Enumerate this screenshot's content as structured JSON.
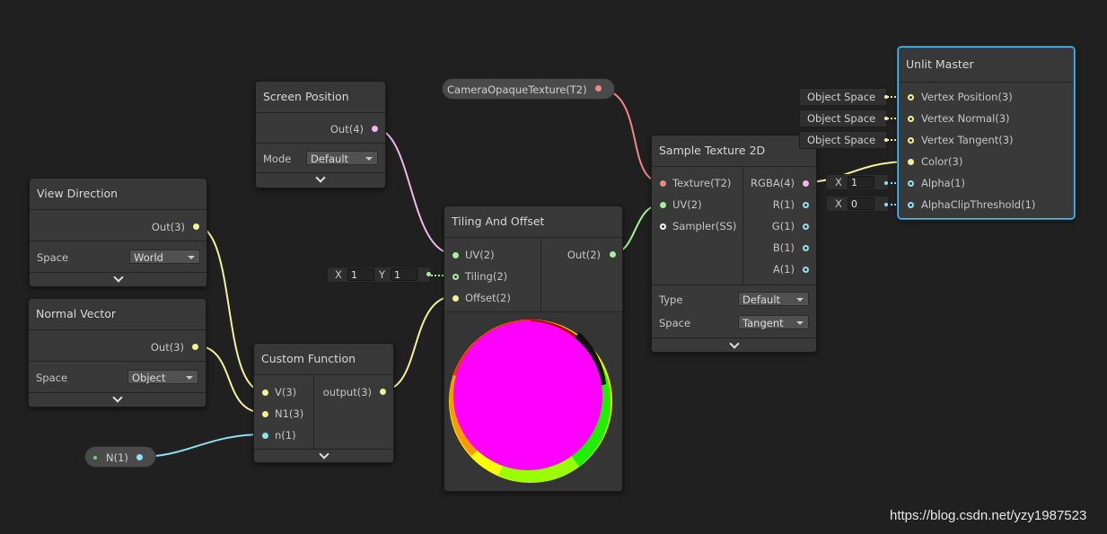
{
  "colors": {
    "vector3": "#f5f09a",
    "vector2": "#a6ef9b",
    "vector4": "#f2b6ee",
    "vector1": "#8fe1f3",
    "texture": "#f28585",
    "sampler": "#ffffff"
  },
  "screen_position": {
    "title": "Screen Position",
    "out_label": "Out(4)",
    "mode_label": "Mode",
    "mode_value": "Default"
  },
  "camera_texture": {
    "label": "CameraOpaqueTexture(T2)"
  },
  "view_direction": {
    "title": "View Direction",
    "out_label": "Out(3)",
    "space_label": "Space",
    "space_value": "World"
  },
  "normal_vector": {
    "title": "Normal Vector",
    "out_label": "Out(3)",
    "space_label": "Space",
    "space_value": "Object"
  },
  "tiling_offset": {
    "title": "Tiling And Offset",
    "uv_label": "UV(2)",
    "tiling_label": "Tiling(2)",
    "offset_label": "Offset(2)",
    "out_label": "Out(2)",
    "tiling_x_label": "X",
    "tiling_x_value": "1",
    "tiling_y_label": "Y",
    "tiling_y_value": "1"
  },
  "custom_function": {
    "title": "Custom Function",
    "inputs": [
      "V(3)",
      "N1(3)",
      "n(1)"
    ],
    "out_label": "output(3)"
  },
  "n_property": {
    "label": "N(1)"
  },
  "sample_texture": {
    "title": "Sample Texture 2D",
    "inputs": [
      "Texture(T2)",
      "UV(2)",
      "Sampler(SS)"
    ],
    "outputs": [
      "RGBA(4)",
      "R(1)",
      "G(1)",
      "B(1)",
      "A(1)"
    ],
    "type_label": "Type",
    "type_value": "Default",
    "space_label": "Space",
    "space_value": "Tangent"
  },
  "unlit_master": {
    "title": "Unlit Master",
    "inputs": [
      "Vertex Position(3)",
      "Vertex Normal(3)",
      "Vertex Tangent(3)",
      "Color(3)",
      "Alpha(1)",
      "AlphaClipThreshold(1)"
    ],
    "space_boxes": [
      "Object Space",
      "Object Space",
      "Object Space"
    ],
    "alpha_x_label": "X",
    "alpha_value": "1",
    "clip_x_label": "X",
    "clip_value": "0"
  },
  "watermark": "https://blog.csdn.net/yzy1987523"
}
